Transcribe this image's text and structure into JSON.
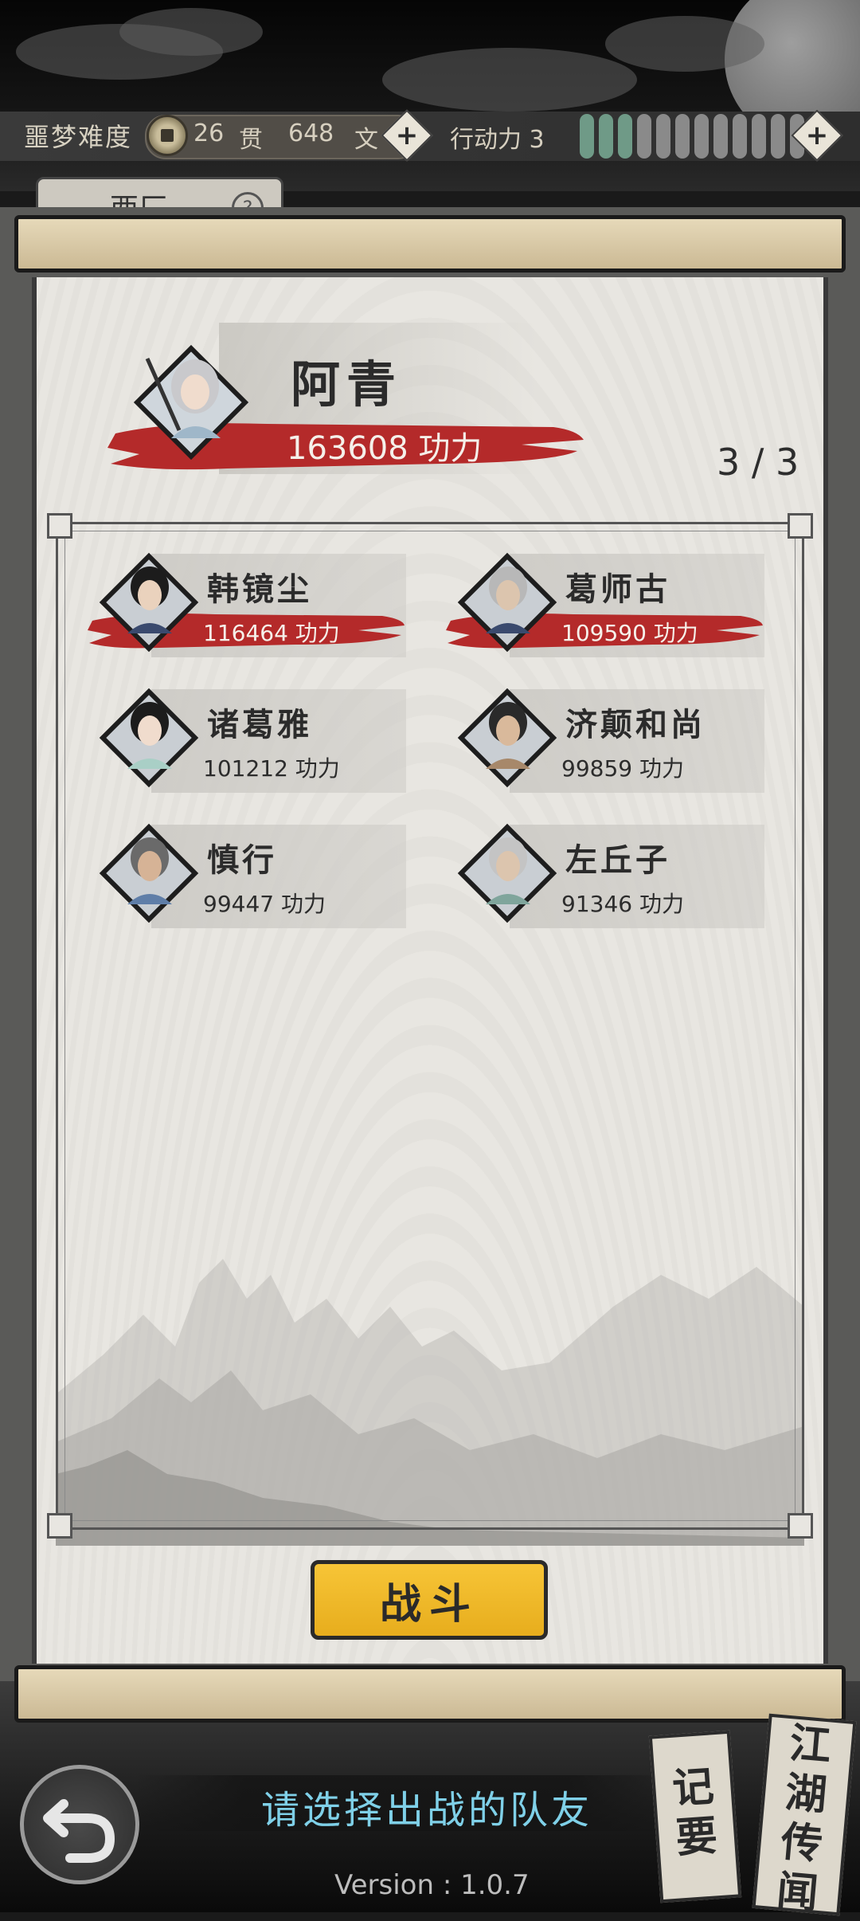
{
  "topbar": {
    "difficulty": "噩梦难度",
    "currency_guan": "26",
    "currency_guan_unit": "贯",
    "currency_wen": "648",
    "currency_wen_unit": "文",
    "energy_label": "行动力 3",
    "energy_max": 12,
    "energy_current": 3
  },
  "background_tab": {
    "title": "西厂",
    "help": "?"
  },
  "hero": {
    "name": "阿青",
    "power": "163608 功力"
  },
  "team_count": "3 / 3",
  "members": [
    {
      "name": "韩镜尘",
      "power": "116464 功力",
      "selected": true
    },
    {
      "name": "葛师古",
      "power": "109590 功力",
      "selected": true
    },
    {
      "name": "诸葛雅",
      "power": "101212 功力",
      "selected": false
    },
    {
      "name": "济颠和尚",
      "power": "99859 功力",
      "selected": false
    },
    {
      "name": "慎行",
      "power": "99447 功力",
      "selected": false
    },
    {
      "name": "左丘子",
      "power": "91346 功力",
      "selected": false
    }
  ],
  "fight_button": "战斗",
  "hint": "请选择出战的队友",
  "version": "Version : 1.0.7",
  "side_buttons": {
    "notes": "记要",
    "rumors": "江湖传闻"
  },
  "colors": {
    "accent_yellow": "#f0bb2c",
    "brush_red": "#b42a2a",
    "hint_cyan": "#7fd0e8"
  }
}
